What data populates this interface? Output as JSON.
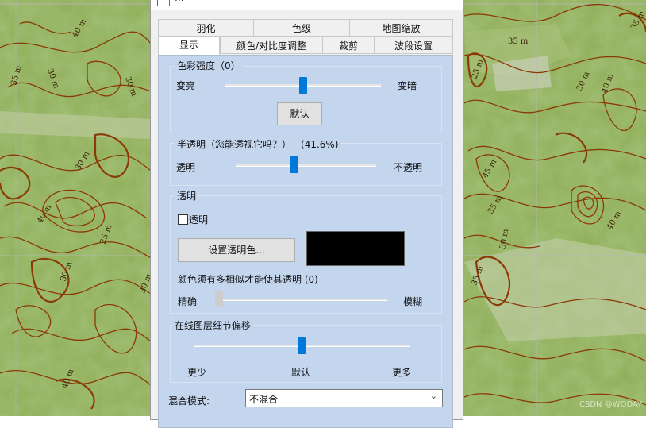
{
  "window": {
    "title": "..."
  },
  "tabs_row1": [
    {
      "label": "羽化"
    },
    {
      "label": "色级"
    },
    {
      "label": "地图缩放"
    }
  ],
  "tabs_row2": [
    {
      "label": "显示"
    },
    {
      "label": "颜色/对比度调整"
    },
    {
      "label": "裁剪"
    },
    {
      "label": "波段设置"
    }
  ],
  "active_tab": "显示",
  "color_intensity": {
    "title": "色彩强度（0）",
    "value": 0,
    "left_label": "变亮",
    "right_label": "变暗",
    "default_button": "默认"
  },
  "translucency": {
    "title": "半透明（您能透视它吗？）",
    "value_text": "(41.6%)",
    "value_percent": 41.6,
    "left_label": "透明",
    "right_label": "不透明"
  },
  "transparency": {
    "title": "透明",
    "checkbox_label": "透明",
    "checked": false,
    "set_color_button": "设置透明色...",
    "color_swatch": "#000000",
    "similarity_label": "颜色须有多相似才能使其透明 (0)",
    "similarity_value": 0,
    "left_label": "精确",
    "right_label": "模糊"
  },
  "online_detail": {
    "title": "在线图层细节偏移",
    "value": 0,
    "left_label": "更少",
    "center_label": "默认",
    "right_label": "更多"
  },
  "blend_mode": {
    "label": "混合模式:",
    "value": "不混合"
  },
  "map": {
    "contour_labels": [
      "40 m",
      "30 m",
      "35 m",
      "30 m",
      "40 m",
      "25 m",
      "30 m",
      "30 m",
      "40 m",
      "30 m",
      "25 m",
      "35 m",
      "45 m",
      "40 m",
      "35 m",
      "30 m",
      "35 m",
      "40 m",
      "35 m",
      "30 m"
    ],
    "watermark": "CSDN @WQDAY",
    "colors": {
      "terrain": "#8fae58",
      "contour": "#8b3a06",
      "grid": "#b7b7b7"
    }
  }
}
